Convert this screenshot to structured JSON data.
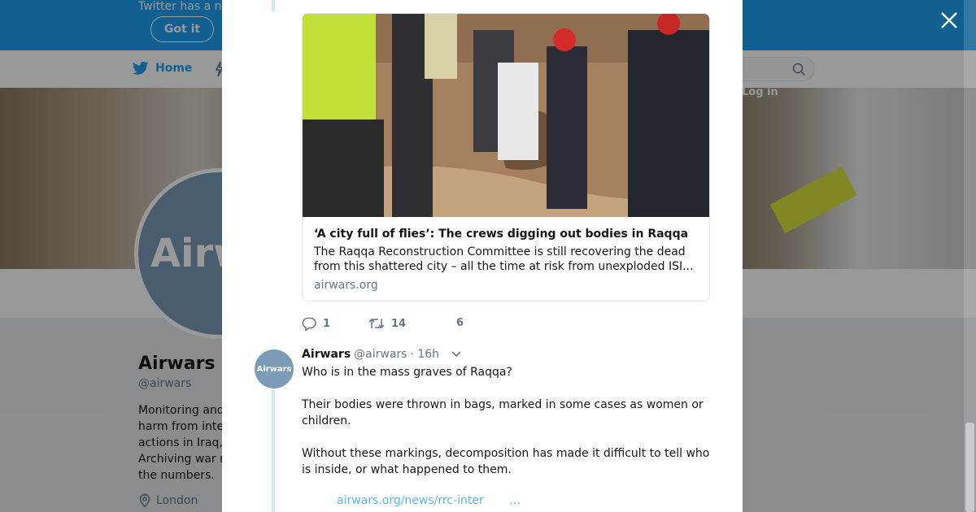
{
  "banner": {
    "text": "Twitter has a n",
    "got_it_label": "Got it"
  },
  "nav": {
    "home_label": "Home",
    "login_label": "Log in"
  },
  "profile": {
    "avatar_text": "Airw",
    "name": "Airwars",
    "handle": "@airwars",
    "bio_lines": [
      "Monitoring and",
      "harm from inte",
      "actions in Iraq,",
      "Archiving war r",
      "the numbers."
    ],
    "location": "London"
  },
  "card": {
    "title": "‘A city full of flies’: The crews digging out bodies in Raqqa",
    "description": "The Raqqa Reconstruction Committee is still recovering the dead from this shattered city – all the time at risk from unexploded ISI...",
    "domain": "airwars.org"
  },
  "actions": {
    "replies": "1",
    "retweets": "14",
    "likes": "6"
  },
  "tweet": {
    "avatar_text": "Airwars",
    "name": "Airwars",
    "handle": "@airwars",
    "time": "· 16h",
    "text": "Who is in the mass graves of Raqqa?\n\nTheir bodies were thrown in bags, marked in some cases as women or children.\n\nWithout these markings, decomposition has made it difficult to tell who is inside, or what happened to them.",
    "link": "airwars.org/news/rrc-inter",
    "more": "…"
  },
  "colors": {
    "accent": "#1da1f2",
    "muted": "#657786",
    "avatar": "#7b9bb8"
  },
  "icons": [
    "twitter-bird-icon",
    "lightning-icon",
    "search-icon",
    "close-icon",
    "reply-icon",
    "retweet-icon",
    "chevron-down-icon",
    "location-pin-icon"
  ]
}
